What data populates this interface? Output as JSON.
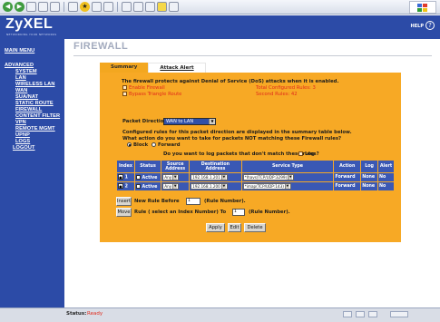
{
  "brand": {
    "name": "ZyXEL",
    "tagline": "NETWORKING YOUR NETWORKS",
    "help_label": "HELP"
  },
  "status": {
    "label": "Status:",
    "value": "Ready"
  },
  "sidebar": {
    "items": [
      {
        "label": "MAIN MENU"
      },
      {
        "label": "ADVANCED"
      },
      {
        "label": "SYSTEM"
      },
      {
        "label": "LAN"
      },
      {
        "label": "WIRELESS LAN"
      },
      {
        "label": "WAN"
      },
      {
        "label": "SUA/NAT"
      },
      {
        "label": "STATIC ROUTE"
      },
      {
        "label": "FIREWALL"
      },
      {
        "label": "CONTENT FILTER"
      },
      {
        "label": "VPN"
      },
      {
        "label": "REMOTE MGMT"
      },
      {
        "label": "UPNP"
      },
      {
        "label": "LOGS"
      },
      {
        "label": "LOGOUT"
      }
    ]
  },
  "page": {
    "title": "FIREWALL"
  },
  "tabs": [
    {
      "label": "Summary"
    },
    {
      "label": "Attack Alert"
    }
  ],
  "firewall": {
    "intro": "The firewall protects against Denial of Service (DoS) attacks when it is enabled.",
    "enable_label": "Enable Firewall",
    "bypass_label": "Bypass Triangle Route",
    "total_rules_label": "Total Configured Rules: 3",
    "second_rules_label": "Second Rules: 42",
    "direction_label": "Packet Direction",
    "direction_value": "WAN to LAN",
    "configured_text_1": "Configured rules for this packet direction are displayed in the summary table below.",
    "configured_text_2": "What action do you want to take for packets NOT matching these Firewall rules?",
    "block_label": "Block",
    "forward_label": "Forward",
    "log_question": "Do you want to log packets that don't match these rules?",
    "log_label": "Log"
  },
  "table": {
    "headers": [
      "Index",
      "Status",
      "Source Address",
      "Destination Address",
      "Service Type",
      "Action",
      "Log",
      "Alert"
    ],
    "rows": [
      {
        "index": "1",
        "status": "Active",
        "source": "Any",
        "destination": "192.168.1.201",
        "service": "*Ihavs(TCP/UDP:3299)",
        "action": "Forward",
        "log": "None",
        "alert": "No"
      },
      {
        "index": "2",
        "status": "Active",
        "source": "Any",
        "destination": "192.168.1.200",
        "service": "*imap(TCP/UDP:143)",
        "action": "Forward",
        "log": "None",
        "alert": "No"
      }
    ]
  },
  "rule_ops": {
    "insert_button": "Insert",
    "insert_text": "New Rule Before",
    "insert_value": "1",
    "insert_suffix": "(Rule Number).",
    "move_button": "Move",
    "move_text": "Rule ( select an Index Number) To",
    "move_value": "1",
    "move_suffix": "(Rule Number)."
  },
  "buttons": {
    "apply": "Apply",
    "edit": "Edit",
    "delete": "Delete"
  },
  "colors": {
    "header_blue": "#2c4ba7",
    "panel_orange": "#f7a925",
    "table_blue": "#3a58b4",
    "alert_red": "#e02a1c"
  }
}
